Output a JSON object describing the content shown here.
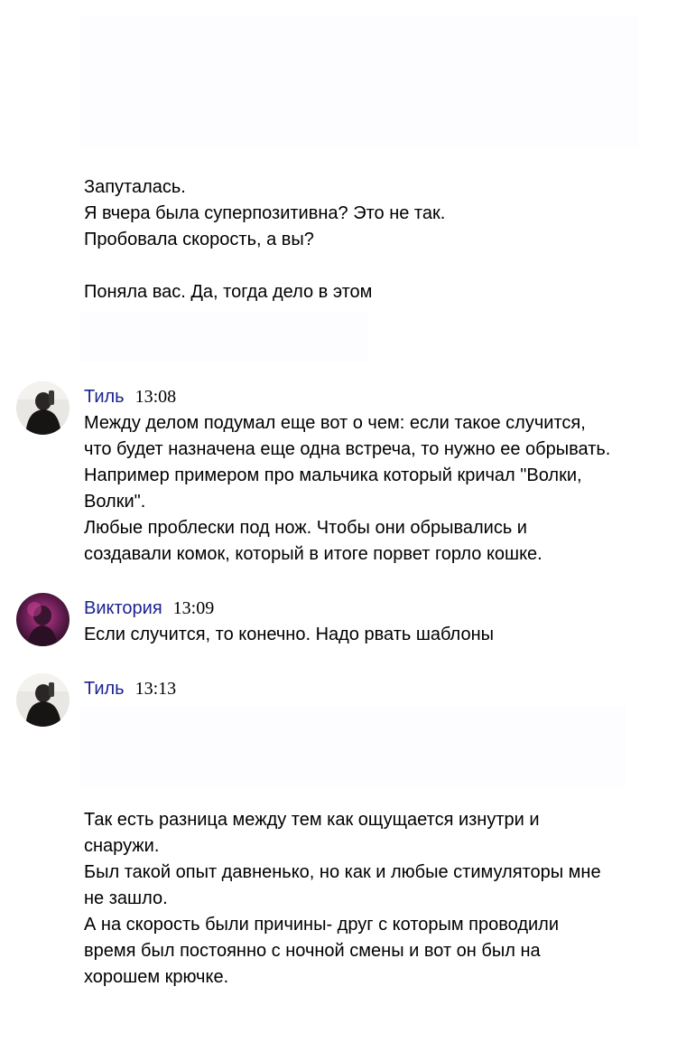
{
  "messages": {
    "top": {
      "lines": [
        "Запуталась.",
        "Я вчера была суперпозитивна? Это не так.",
        "Пробовала скорость, а вы?",
        "",
        "Поняла вас. Да, тогда дело в этом"
      ]
    },
    "til_1": {
      "author": "Тиль",
      "time": "13:08",
      "lines": [
        "Между делом подумал еще вот о чем: если такое случится,",
        "что будет назначена еще одна встреча, то нужно ее обрывать.",
        "Например примером про мальчика который кричал \"Волки,",
        "Волки\".",
        "Любые проблески под нож. Чтобы они обрывались и",
        "создавали комок, который в итоге порвет горло кошке."
      ]
    },
    "viktoria": {
      "author": "Виктория",
      "time": "13:09",
      "lines": [
        "Если случится, то конечно. Надо рвать шаблоны"
      ]
    },
    "til_2": {
      "author": "Тиль",
      "time": "13:13",
      "lines": [
        "Так есть разница между тем как ощущается изнутри и",
        "снаружи.",
        "Был такой опыт давненько, но как и любые стимуляторы мне",
        "не зашло.",
        "А на скорость были причины- друг с которым проводили",
        "время был постоянно с ночной смены и вот он был на",
        "хорошем крючке."
      ]
    }
  },
  "colors": {
    "author": "#1d2390",
    "text": "#000000",
    "background": "#ffffff"
  }
}
